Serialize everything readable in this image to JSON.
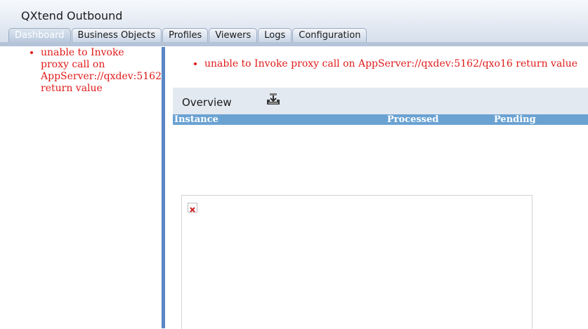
{
  "app": {
    "title": "QXtend Outbound"
  },
  "tabs": [
    {
      "label": "Dashboard",
      "active": true
    },
    {
      "label": "Business Objects",
      "active": false
    },
    {
      "label": "Profiles",
      "active": false
    },
    {
      "label": "Viewers",
      "active": false
    },
    {
      "label": "Logs",
      "active": false
    },
    {
      "label": "Configuration",
      "active": false
    }
  ],
  "sidebar": {
    "error_message": "unable to Invoke\nproxy call on\nAppServer://qxdev:5162\nreturn value"
  },
  "main": {
    "error_message": "unable to Invoke proxy call on AppServer://qxdev:5162/qxo16 return value",
    "overview": {
      "title": "Overview",
      "action_icon": "download-tray-icon",
      "columns": [
        "Instance",
        "Processed",
        "Pending"
      ]
    },
    "panel": {
      "image_icon": "broken-image-icon"
    }
  },
  "colors": {
    "error_text": "#e01b1b",
    "splitter": "#5a87c5",
    "table_header": "#6aa2d2",
    "overview_bar": "#e3e9f1"
  }
}
